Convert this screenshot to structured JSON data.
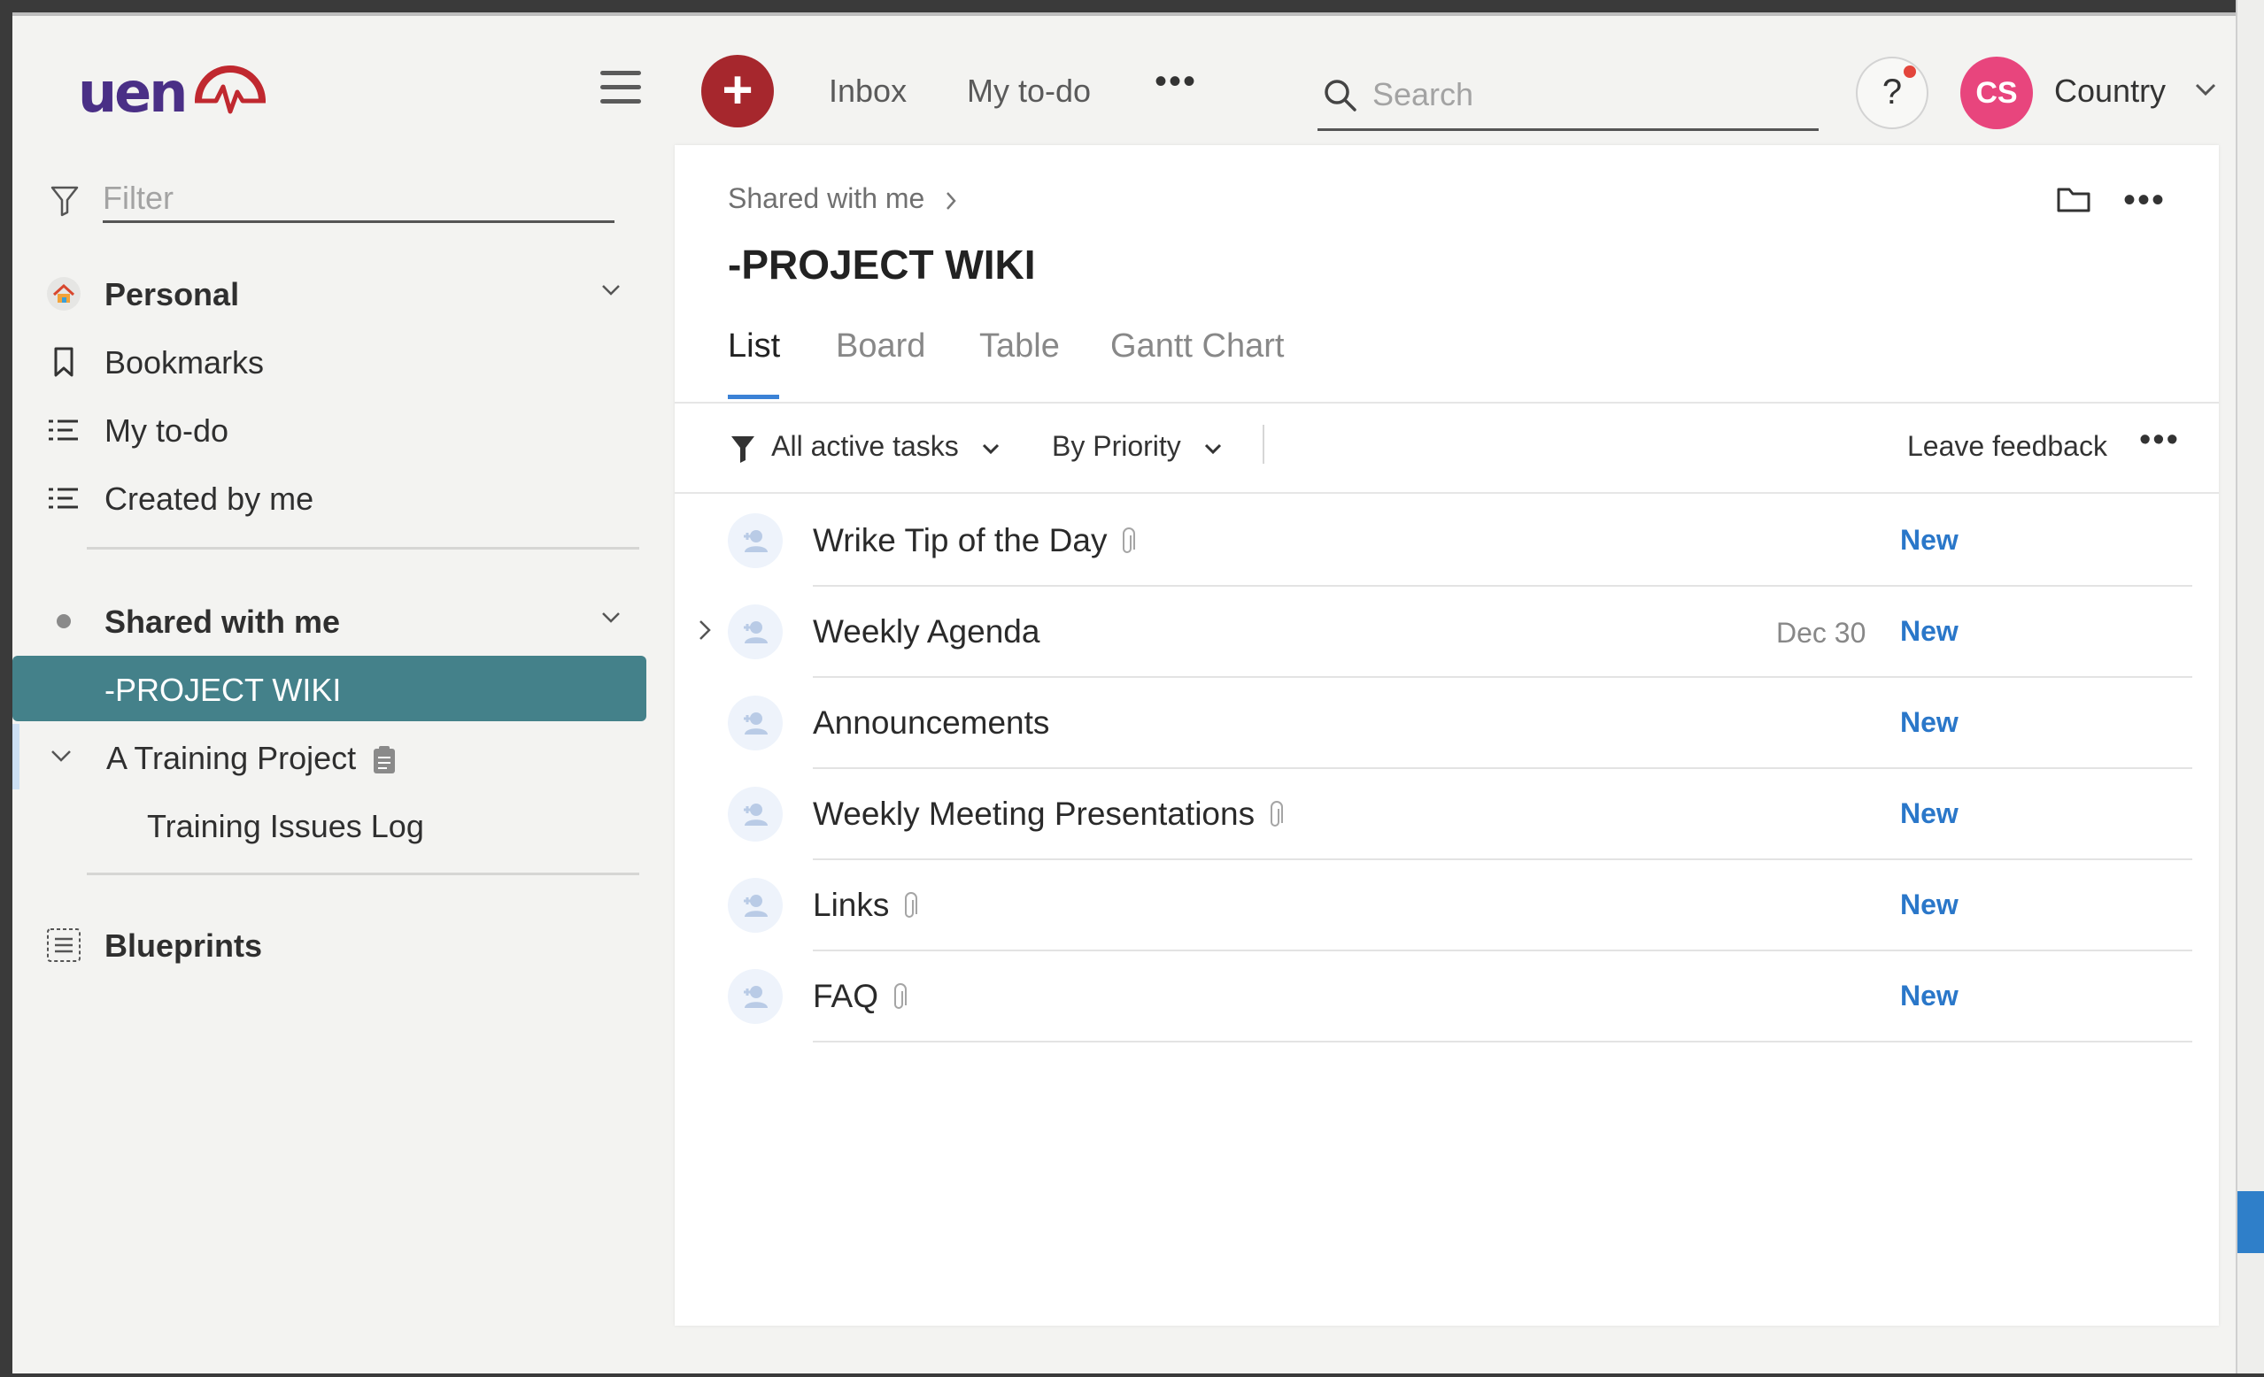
{
  "brand": {
    "logo_text": "uen"
  },
  "colors": {
    "accent": "#44818a",
    "add_button": "#a6272d",
    "avatar": "#e8457d",
    "status_new": "#2a77c9",
    "tab_underline": "#3b82d6"
  },
  "topnav": {
    "links": [
      "Inbox",
      "My to-do"
    ],
    "more": "•••",
    "search_placeholder": "Search",
    "help_label": "?",
    "avatar_initials": "CS",
    "account_name": "Country"
  },
  "sidebar": {
    "filter_placeholder": "Filter",
    "personal": "Personal",
    "items": [
      "Bookmarks",
      "My to-do",
      "Created by me"
    ],
    "shared_with_me": "Shared with me",
    "projects": [
      {
        "label": "-PROJECT WIKI",
        "active": true
      },
      {
        "label": "A Training Project",
        "expanded": true
      },
      {
        "label": "Training Issues Log"
      }
    ],
    "blueprints": "Blueprints"
  },
  "main": {
    "breadcrumb": "Shared with me",
    "title": "-PROJECT WIKI",
    "tabs": [
      "List",
      "Board",
      "Table",
      "Gantt Chart"
    ],
    "active_tab": "List",
    "toolbar": {
      "filter": "All active tasks",
      "group": "By Priority",
      "feedback": "Leave feedback",
      "more": "•••"
    },
    "tasks": [
      {
        "name": "Wrike Tip of the Day",
        "attachment": true,
        "date": "",
        "status": "New"
      },
      {
        "name": "Weekly Agenda",
        "attachment": false,
        "date": "Dec 30",
        "status": "New",
        "expandable": true
      },
      {
        "name": "Announcements",
        "attachment": false,
        "date": "",
        "status": "New"
      },
      {
        "name": "Weekly Meeting Presentations",
        "attachment": true,
        "date": "",
        "status": "New"
      },
      {
        "name": "Links",
        "attachment": true,
        "date": "",
        "status": "New"
      },
      {
        "name": "FAQ",
        "attachment": true,
        "date": "",
        "status": "New"
      }
    ]
  }
}
